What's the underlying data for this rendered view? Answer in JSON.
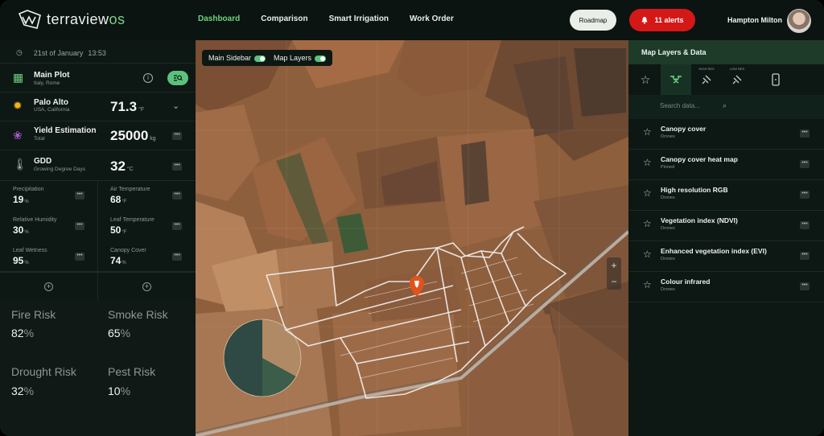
{
  "brand": {
    "name": "terraview",
    "suffix": "os"
  },
  "nav": [
    "Dashboard",
    "Comparison",
    "Smart Irrigation",
    "Work Order"
  ],
  "header": {
    "roadmap": "Roadmap",
    "alerts": "11 alerts",
    "user": "Hampton Milton"
  },
  "sidebar": {
    "date": "21st of January",
    "time": "13:53",
    "plot": {
      "title": "Main Plot",
      "sub": "Italy, Rome"
    },
    "weather": {
      "city": "Palo Alto",
      "region": "USA, California",
      "value": "71.3",
      "unit": "°F"
    },
    "yield": {
      "title": "Yield Estimation",
      "sub": "Total",
      "value": "25000",
      "unit": "kg"
    },
    "gdd": {
      "title": "GDD",
      "sub": "Growing Degree Days",
      "value": "32",
      "unit": "°C"
    },
    "metrics": [
      {
        "label": "Precipitation",
        "value": "19",
        "unit": "%"
      },
      {
        "label": "Air Temperature",
        "value": "68",
        "unit": "°F"
      },
      {
        "label": "Relative Humidity",
        "value": "30",
        "unit": "%"
      },
      {
        "label": "Leaf Temperature",
        "value": "50",
        "unit": "°F"
      },
      {
        "label": "Leaf Wetness",
        "value": "95",
        "unit": "%"
      },
      {
        "label": "Canopy Cover",
        "value": "74",
        "unit": "%"
      }
    ],
    "risks": [
      {
        "label": "Fire Risk",
        "value": "82",
        "unit": "%"
      },
      {
        "label": "Smoke Risk",
        "value": "65",
        "unit": "%"
      },
      {
        "label": "Drought Risk",
        "value": "32",
        "unit": "%"
      },
      {
        "label": "Pest Risk",
        "value": "10",
        "unit": "%"
      }
    ]
  },
  "map": {
    "toggle_sidebar": "Main Sidebar",
    "toggle_layers": "Map Layers"
  },
  "layers_panel": {
    "title": "Map Layers & Data",
    "tab_captions": [
      "HIGH RES",
      "LOW RES"
    ],
    "search_placeholder": "Search data...",
    "items": [
      {
        "name": "Canopy cover",
        "sub": "Drones"
      },
      {
        "name": "Canopy cover heat map",
        "sub": "Pinned"
      },
      {
        "name": "High resolution RGB",
        "sub": "Drones"
      },
      {
        "name": "Vegetation index (NDVI)",
        "sub": "Drones"
      },
      {
        "name": "Enhanced vegetation index (EVI)",
        "sub": "Drones"
      },
      {
        "name": "Colour infrared",
        "sub": "Drones"
      }
    ]
  },
  "colors": {
    "accent": "#6fd27f",
    "alert": "#d41818",
    "panel_header": "#1e3b2a",
    "pin": "#e0541c"
  }
}
